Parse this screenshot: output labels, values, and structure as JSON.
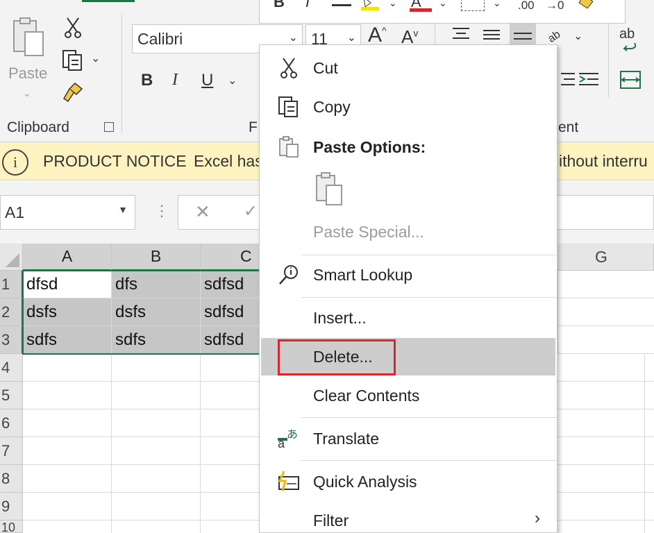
{
  "ribbon": {
    "clipboard": {
      "paste_label": "Paste",
      "group_label": "Clipboard"
    },
    "font": {
      "font_name": "Calibri",
      "font_size": "11",
      "bold": "B",
      "italic": "I",
      "underline": "U",
      "group_label_partial": "F"
    },
    "top_strip": {
      "bold": "B",
      "italic": "I",
      "font_color": "A",
      "decimal_increase": ".00",
      "decimal_decrease": "→0"
    },
    "alignment": {
      "group_label_partial": "ent",
      "wrap_text_icon_label": "ab"
    }
  },
  "notice": {
    "title": "PRODUCT NOTICE",
    "text_left": "Excel has",
    "text_right": "ithout interru"
  },
  "formula_bar": {
    "name_box": "A1"
  },
  "grid": {
    "columns": [
      "A",
      "B",
      "C",
      "G"
    ],
    "rows": [
      "1",
      "2",
      "3",
      "4",
      "5",
      "6",
      "7",
      "8",
      "9",
      "10"
    ],
    "cells": [
      [
        "dfsd",
        "dfs",
        "sdfsd"
      ],
      [
        "dsfs",
        "dsfs",
        "sdfsd"
      ],
      [
        "sdfs",
        "sdfs",
        "sdfsd"
      ]
    ]
  },
  "context_menu": {
    "cut": "Cut",
    "copy": "Copy",
    "paste_options": "Paste Options:",
    "paste_special": "Paste Special...",
    "smart_lookup": "Smart Lookup",
    "insert": "Insert...",
    "delete": "Delete...",
    "clear_contents": "Clear Contents",
    "translate": "Translate",
    "quick_analysis": "Quick Analysis",
    "filter": "Filter"
  },
  "colors": {
    "accent_green": "#217346",
    "highlight_red": "#d9262c",
    "notice_bg": "#fdf3c1"
  }
}
